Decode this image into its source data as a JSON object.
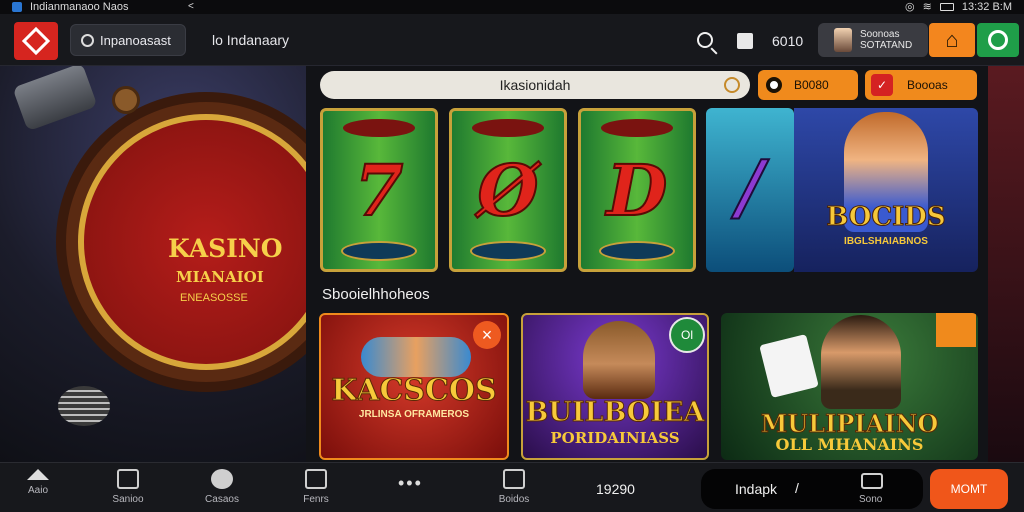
{
  "status_bar": {
    "app_title": "Indianmanaoo Naos",
    "time": "13:32 B:M"
  },
  "header": {
    "search_chip_label": "Inpanoasast",
    "nav_link": "lo Indanaary",
    "count": "6010",
    "profile_line1": "Soonoas",
    "profile_line2": "SOTATAND"
  },
  "main": {
    "search_text": "Ikasionidah",
    "coin_button_label": "B0080",
    "promo_button_label": "Boooas",
    "reels": [
      "7",
      "Ø",
      "D",
      "/"
    ],
    "hero_title": "BOCIDS",
    "hero_subtitle": "IBGLSHAIABNOS",
    "section_title": "Sbooielhhoheos",
    "games": [
      {
        "title": "KACSCOS",
        "subtitle": "JRLINSA OFRAMEROS"
      },
      {
        "title": "BUILBOIEA",
        "subtitle": "PORIDAINIASS",
        "badge": "Ol"
      },
      {
        "title": "MULIPIAINO",
        "subtitle": "OLL MHANAINS"
      }
    ]
  },
  "left_art": {
    "title": "KASINO",
    "subtitle": "MIANAIOI",
    "tagline": "ENEASOSSE"
  },
  "bottom_bar": {
    "tabs": [
      "Aaio",
      "Sanioo",
      "Casaos",
      "Fenrs",
      "Boidos"
    ],
    "count": "19290",
    "install_label": "Indapk",
    "install_icon_label": "Sono",
    "more_label": "MOMT"
  },
  "colors": {
    "accent_orange": "#f08a1c",
    "brand_red": "#d6251f",
    "green": "#1f9e49"
  }
}
